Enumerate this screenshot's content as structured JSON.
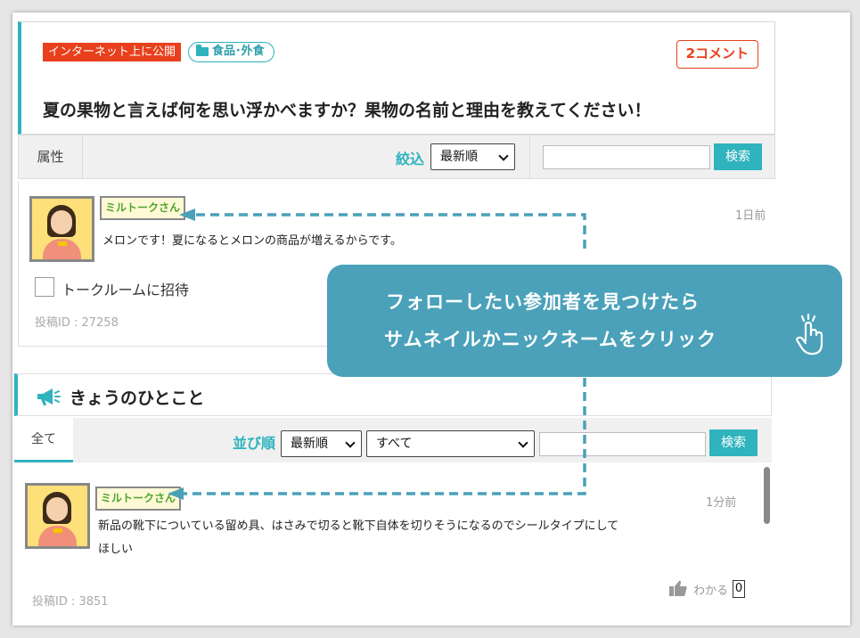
{
  "post": {
    "public_badge": "インターネット上に公開",
    "category": "食品･外食",
    "comment_count": "2コメント",
    "title": "夏の果物と言えば何を思い浮かべますか？果物の名前と理由を教えてください！"
  },
  "filter_bar_1": {
    "attribute_tab": "属性",
    "filter_label": "絞込",
    "sort_selected": "最新順",
    "search_value": "",
    "search_button": "検索"
  },
  "comment": {
    "nickname": "ミルトークさん",
    "timestamp": "1日前",
    "body": "メロンです！夏になるとメロンの商品が増えるからです。",
    "invite_label": "トークルームに招待",
    "post_id": "投稿ID : 27258"
  },
  "callout": {
    "line1": "フォローしたい参加者を見つけたら",
    "line2": "サムネイルかニックネームをクリック"
  },
  "hitokoto": {
    "section_title": "きょうのひとこと",
    "tab_all": "全て",
    "sort_label": "並び順",
    "sort_selected": "最新順",
    "filter_selected": "すべて",
    "search_value": "",
    "search_button": "検索",
    "item": {
      "nickname": "ミルトークさん",
      "timestamp": "1分前",
      "body_line1": "新品の靴下についている留め具、はさみで切ると靴下自体を切りそうになるのでシールタイプにして",
      "body_line2": "ほしい",
      "post_id": "投稿ID : 3851",
      "like_label": "わかる",
      "like_count": "0"
    }
  },
  "colors": {
    "accent": "#2fb3bd",
    "public_badge": "#e8401c",
    "callout": "#4aa1b9",
    "nickname_text": "#4ea52f"
  }
}
